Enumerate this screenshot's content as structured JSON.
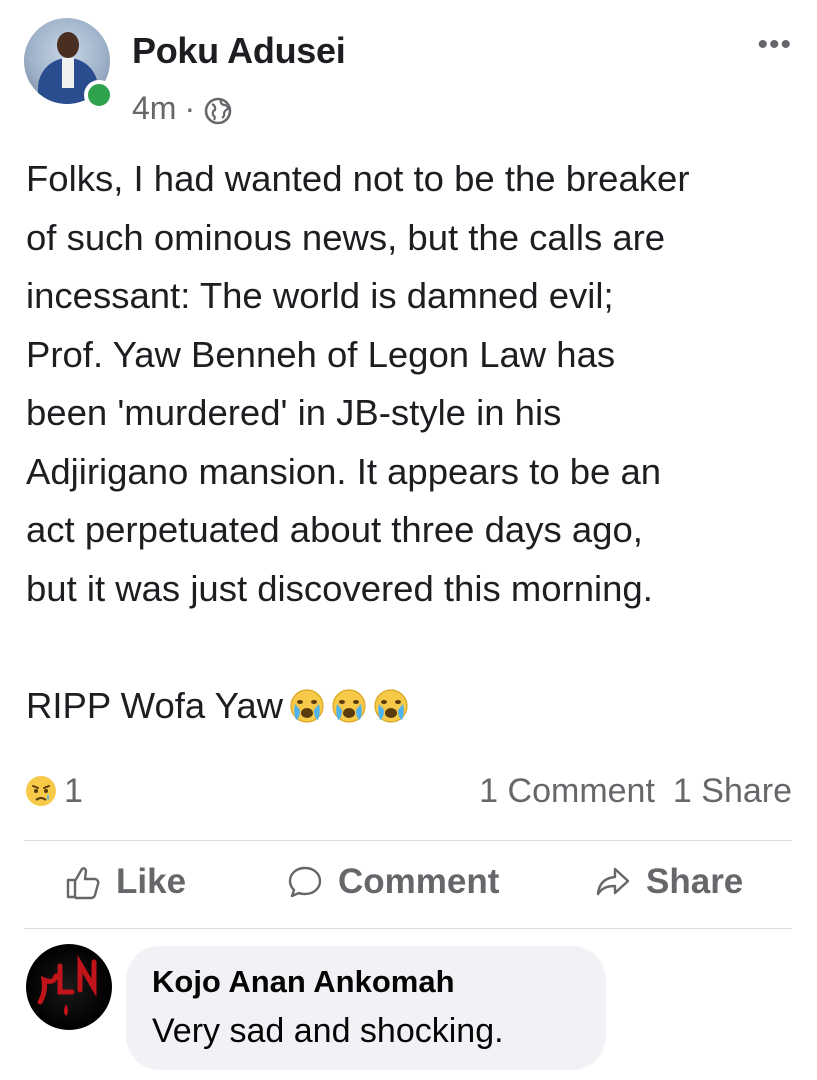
{
  "post": {
    "author_name": "Poku Adusei",
    "timestamp": "4m",
    "separator": "·",
    "audience_icon": "globe-icon",
    "more_icon": "•••",
    "text": "Folks, I had wanted not to be the breaker\nof such ominous news, but the calls are\nincessant: The world is damned evil;\nProf. Yaw Benneh of Legon Law has\nbeen 'murdered' in JB-style in his\nAdjirigano mansion. It appears to be an\nact perpetuated about three days ago,\nbut it was just discovered this morning.\n\nRIPP Wofa Yaw",
    "trailing_emoji": [
      "crying-face",
      "crying-face",
      "crying-face"
    ]
  },
  "reactions": {
    "icon": "sad-reaction-icon",
    "count": "1",
    "comments_label": "1 Comment",
    "shares_label": "1 Share"
  },
  "actions": {
    "like_label": "Like",
    "comment_label": "Comment",
    "share_label": "Share"
  },
  "comment": {
    "author_name": "Kojo Anan Ankomah",
    "text": "Very sad and shocking."
  },
  "colors": {
    "online_green": "#31a24c",
    "secondary_text": "#65676b",
    "bubble_bg": "#f0f2f5",
    "primary_text": "#1c1e21"
  }
}
